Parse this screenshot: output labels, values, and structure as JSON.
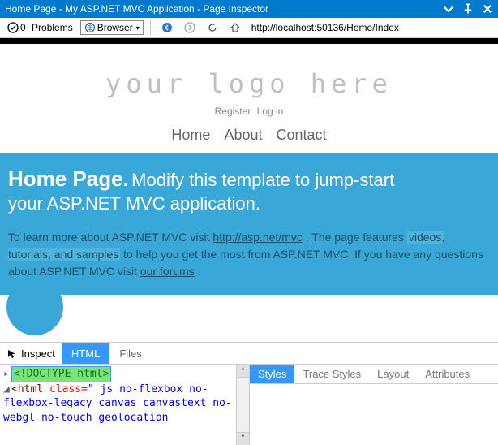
{
  "titlebar": {
    "title": "Home Page - My ASP.NET MVC Application - Page Inspector"
  },
  "toolbar": {
    "problems_count": "0",
    "problems_label": "Problems",
    "browser_label": "Browser",
    "url": "http://localhost:50136/Home/Index"
  },
  "page": {
    "logo": "your logo here",
    "register": "Register",
    "login": "Log in",
    "nav": {
      "home": "Home",
      "about": "About",
      "contact": "Contact"
    },
    "hero": {
      "title": "Home Page.",
      "sub": "Modify this template to jump-start",
      "line2": "your ASP.NET MVC application."
    },
    "desc": {
      "t1": "To learn more about ASP.NET MVC visit ",
      "link1": "http://asp.net/mvc",
      "t2": " . The page features ",
      "hl": "videos, tutorials, and samples",
      "t3": " to help you get the most from ASP.NET MVC. If you have any questions about ASP.NET MVC visit ",
      "link2": "our forums",
      "t4": " ."
    }
  },
  "panel": {
    "inspect": "Inspect",
    "tabs": {
      "html": "HTML",
      "files": "Files"
    },
    "right_tabs": {
      "styles": "Styles",
      "trace": "Trace Styles",
      "layout": "Layout",
      "attributes": "Attributes"
    },
    "code": {
      "doctype": "<!DOCTYPE html>",
      "l1a": "<html",
      "l1b": " class=",
      "l1c": "\" js no-flexbox no-flexbox-legacy canvas canvastext no-webgl no-touch geolocation"
    }
  }
}
